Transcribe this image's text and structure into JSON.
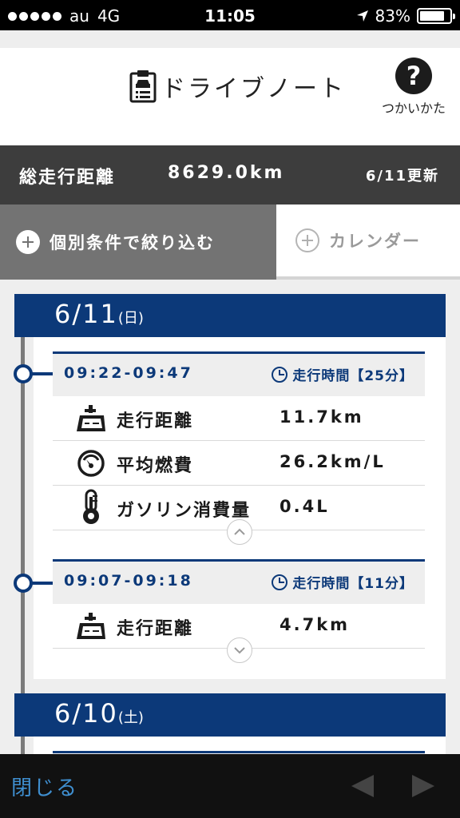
{
  "status_bar": {
    "carrier": "au",
    "network": "4G",
    "time": "11:05",
    "battery": "83%",
    "battery_level": 0.83
  },
  "header": {
    "title": "ドライブノート",
    "help_label": "つかいかた",
    "help_symbol": "?"
  },
  "summary": {
    "label": "総走行距離",
    "value": "8629.0km",
    "updated": "6/11更新"
  },
  "filters": {
    "filter_label": "個別条件で絞り込む",
    "calendar_label": "カレンダー"
  },
  "days": [
    {
      "date": "6/11",
      "weekday": "(日)",
      "trips": [
        {
          "time_range": "09:22-09:47",
          "duration": "走行時間【25分】",
          "metrics": [
            {
              "icon": "road-distance-icon",
              "label": "走行距離",
              "value": "11.7km"
            },
            {
              "icon": "fuel-gauge-icon",
              "label": "平均燃費",
              "value": "26.2km/L"
            },
            {
              "icon": "thermometer-icon",
              "label": "ガソリン消費量",
              "value": "0.4L"
            }
          ],
          "expanded": true
        },
        {
          "time_range": "09:07-09:18",
          "duration": "走行時間【11分】",
          "metrics": [
            {
              "icon": "road-distance-icon",
              "label": "走行距離",
              "value": "4.7km"
            }
          ],
          "expanded": false
        }
      ]
    },
    {
      "date": "6/10",
      "weekday": "(土)",
      "trips": []
    }
  ],
  "toolbar": {
    "close_label": "閉じる"
  },
  "colors": {
    "navy": "#0c3979",
    "dark_bar": "#3d3d3d",
    "filter_active": "#737373",
    "link_blue": "#3f8fd0"
  }
}
